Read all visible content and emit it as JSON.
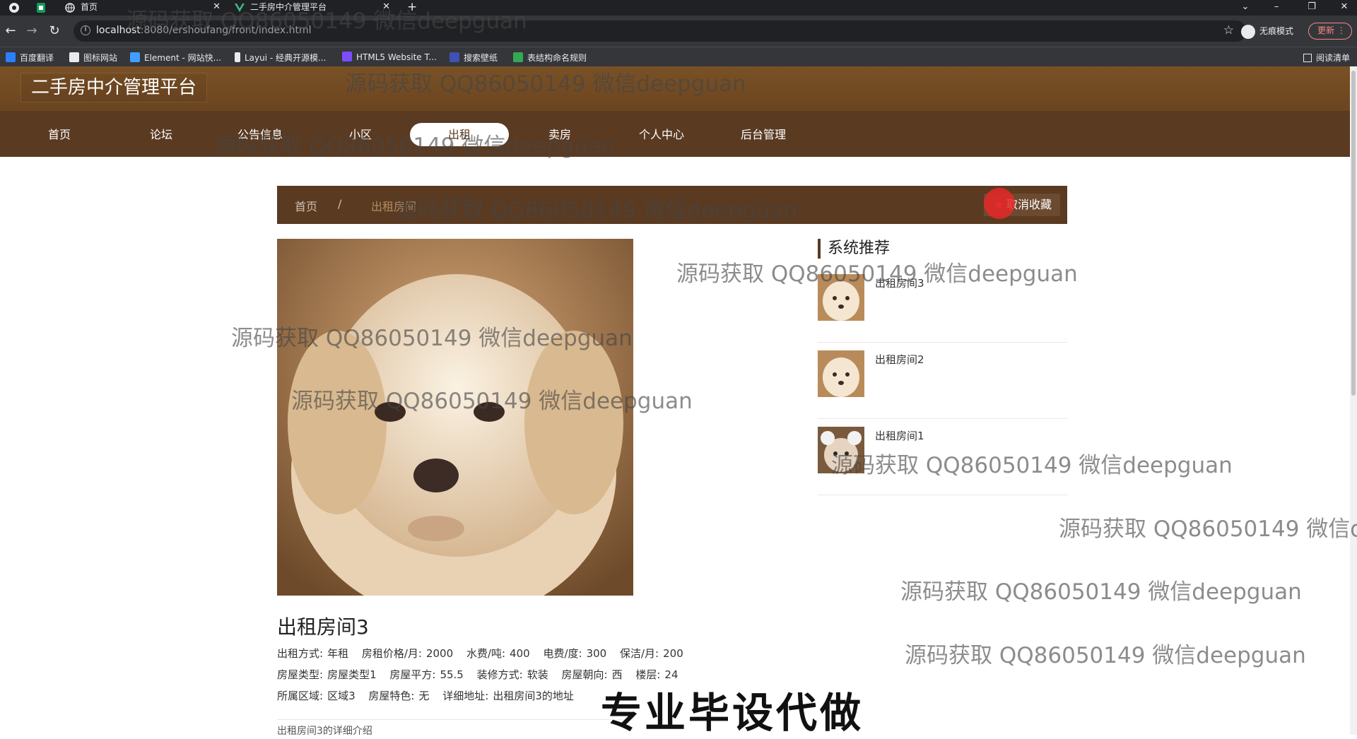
{
  "browser": {
    "tabs": [
      {
        "title": "首页"
      },
      {
        "title": "二手房中介管理平台"
      }
    ],
    "url_host": "localhost",
    "url_rest": ":8080/ershoufang/front/index.html",
    "incognito_label": "无痕模式",
    "update_label": "更新",
    "bookmarks": [
      {
        "label": "百度翻译",
        "color": "#2d7ff9"
      },
      {
        "label": "图标网站",
        "color": "#e8eaed"
      },
      {
        "label": "Element - 网站快...",
        "color": "#409eff"
      },
      {
        "label": "Layui - 经典开源模...",
        "color": "#e8eaed"
      },
      {
        "label": "HTML5 Website T...",
        "color": "#7c4dff"
      },
      {
        "label": "搜索壁纸",
        "color": "#3f51b5"
      },
      {
        "label": "表结构命名规则",
        "color": "#34a853"
      }
    ],
    "reading_list": "阅读清单"
  },
  "site": {
    "title": "二手房中介管理平台",
    "nav": [
      "首页",
      "论坛",
      "公告信息",
      "小区",
      "出租",
      "卖房",
      "个人中心",
      "后台管理"
    ],
    "active_nav": "出租",
    "brand_color": "#5a3a21"
  },
  "breadcrumb": {
    "home": "首页",
    "separator": "/",
    "current": "出租房间"
  },
  "favorite_button": {
    "star": "★",
    "label": "取消收藏"
  },
  "detail": {
    "title": "出租房间3",
    "line1": [
      {
        "k": "出租方式:",
        "v": "年租"
      },
      {
        "k": "房租价格/月:",
        "v": "2000"
      },
      {
        "k": "水费/吨:",
        "v": "400"
      },
      {
        "k": "电费/度:",
        "v": "300"
      },
      {
        "k": "保洁/月:",
        "v": "200"
      }
    ],
    "line2": [
      {
        "k": "房屋类型:",
        "v": "房屋类型1"
      },
      {
        "k": "房屋平方:",
        "v": "55.5"
      },
      {
        "k": "装修方式:",
        "v": "软装"
      },
      {
        "k": "房屋朝向:",
        "v": "西"
      },
      {
        "k": "楼层:",
        "v": "24"
      }
    ],
    "line3": [
      {
        "k": "所属区域:",
        "v": "区域3"
      },
      {
        "k": "房屋特色:",
        "v": "无"
      },
      {
        "k": "详细地址:",
        "v": "出租房间3的地址"
      }
    ],
    "description": "出租房间3的详细介绍"
  },
  "recommend": {
    "title": "系统推荐",
    "items": [
      {
        "name": "出租房间3"
      },
      {
        "name": "出租房间2"
      },
      {
        "name": "出租房间1"
      }
    ]
  },
  "watermark": "源码获取 QQ86050149 微信deepguan",
  "caption": "专业毕设代做"
}
